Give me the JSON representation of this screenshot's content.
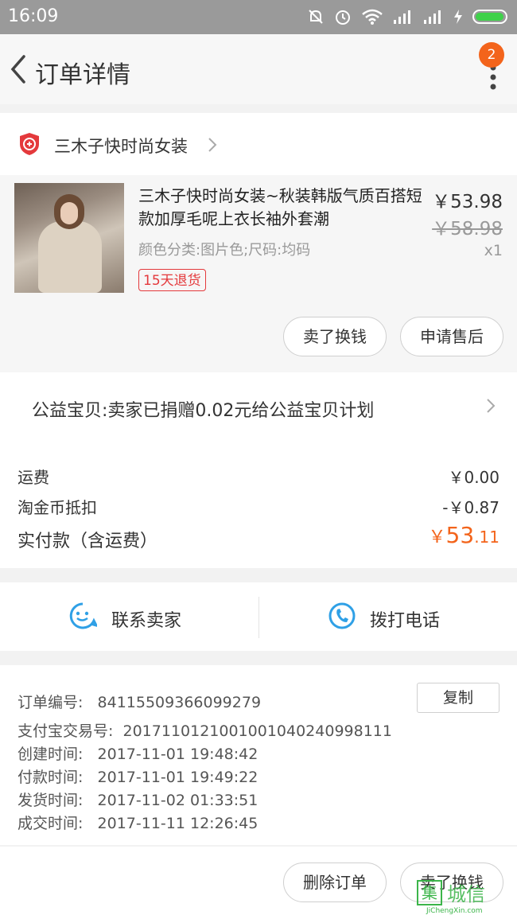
{
  "status_bar": {
    "time": "16:09"
  },
  "nav": {
    "title": "订单详情",
    "badge_count": "2"
  },
  "shop": {
    "name": "三木子快时尚女装"
  },
  "product": {
    "title": "三木子快时尚女装~秋装韩版气质百搭短款加厚毛呢上衣长袖外套潮",
    "price": "￥53.98",
    "original_price": "￥58.98",
    "quantity": "x1",
    "spec": "颜色分类:图片色;尺码:均码",
    "return_tag": "15天退货",
    "buttons": {
      "sell": "卖了换钱",
      "after_sale": "申请售后"
    }
  },
  "charity": {
    "text": "公益宝贝:卖家已捐赠0.02元给公益宝贝计划"
  },
  "fees": {
    "shipping_label": "运费",
    "shipping_value": "￥0.00",
    "coin_label": "淘金币抵扣",
    "coin_value": "-￥0.87",
    "paid_label": "实付款（含运费）",
    "paid_currency": "￥",
    "paid_int": "53",
    "paid_dec": ".11"
  },
  "contact": {
    "seller": "联系卖家",
    "call": "拨打电话"
  },
  "order_info": {
    "copy_button": "复制",
    "rows": [
      {
        "label": "订单编号:",
        "value": "84115509366099279"
      },
      {
        "label": "支付宝交易号:",
        "value": "20171101210010010402409981​11"
      },
      {
        "label": "创建时间:",
        "value": "2017-11-01 19:48:42"
      },
      {
        "label": "付款时间:",
        "value": "2017-11-01 19:49:22"
      },
      {
        "label": "发货时间:",
        "value": "2017-11-02 01:33:51"
      },
      {
        "label": "成交时间:",
        "value": "2017-11-11 12:26:45"
      }
    ]
  },
  "bottom": {
    "delete": "删除订单",
    "sell": "卖了换钱"
  },
  "watermark": {
    "logo": "集",
    "cn": "城信",
    "en": "JiChengXin.com"
  },
  "colors": {
    "accent": "#f3641b",
    "tag_red": "#e4393c",
    "blue_icon": "#2fa0e6"
  }
}
